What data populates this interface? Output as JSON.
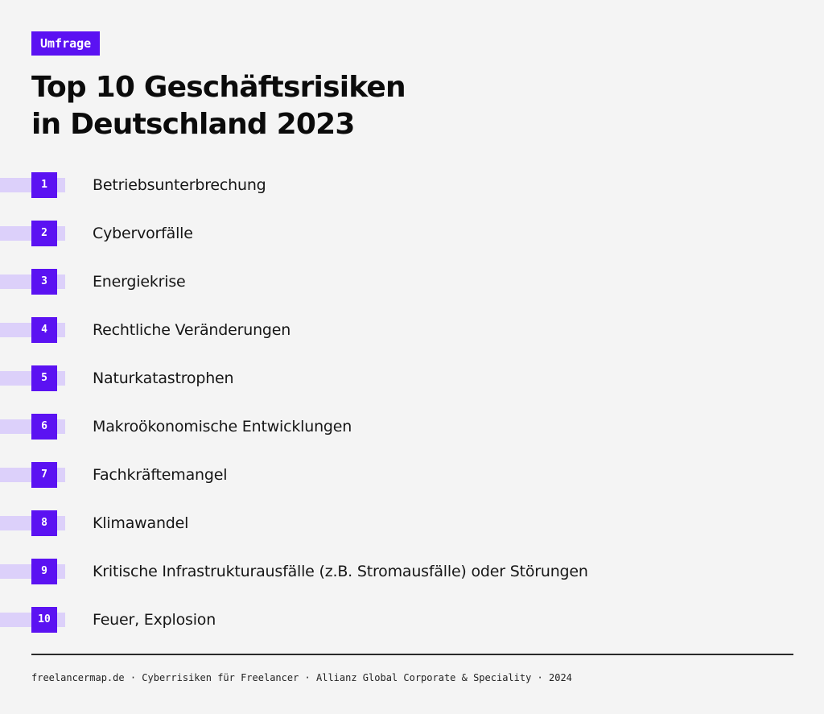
{
  "tag": "Umfrage",
  "title_line1": "Top 10 Geschäftsrisiken",
  "title_line2": "in Deutschland 2023",
  "colors": {
    "accent": "#5b12f2",
    "bar": "#dcd0fa",
    "background": "#f4f4f4"
  },
  "items": [
    {
      "rank": "1",
      "label": "Betriebsunterbrechung"
    },
    {
      "rank": "2",
      "label": "Cybervorfälle"
    },
    {
      "rank": "3",
      "label": "Energiekrise"
    },
    {
      "rank": "4",
      "label": "Rechtliche Veränderungen"
    },
    {
      "rank": "5",
      "label": "Naturkatastrophen"
    },
    {
      "rank": "6",
      "label": "Makroökonomische Entwicklungen"
    },
    {
      "rank": "7",
      "label": "Fachkräftemangel"
    },
    {
      "rank": "8",
      "label": "Klimawandel"
    },
    {
      "rank": "9",
      "label": "Kritische Infrastrukturausfälle (z.B. Stromausfälle) oder Störungen"
    },
    {
      "rank": "10",
      "label": "Feuer, Explosion"
    }
  ],
  "footer": "freelancermap.de · Cyberrisiken für Freelancer · Allianz Global Corporate & Speciality · 2024"
}
